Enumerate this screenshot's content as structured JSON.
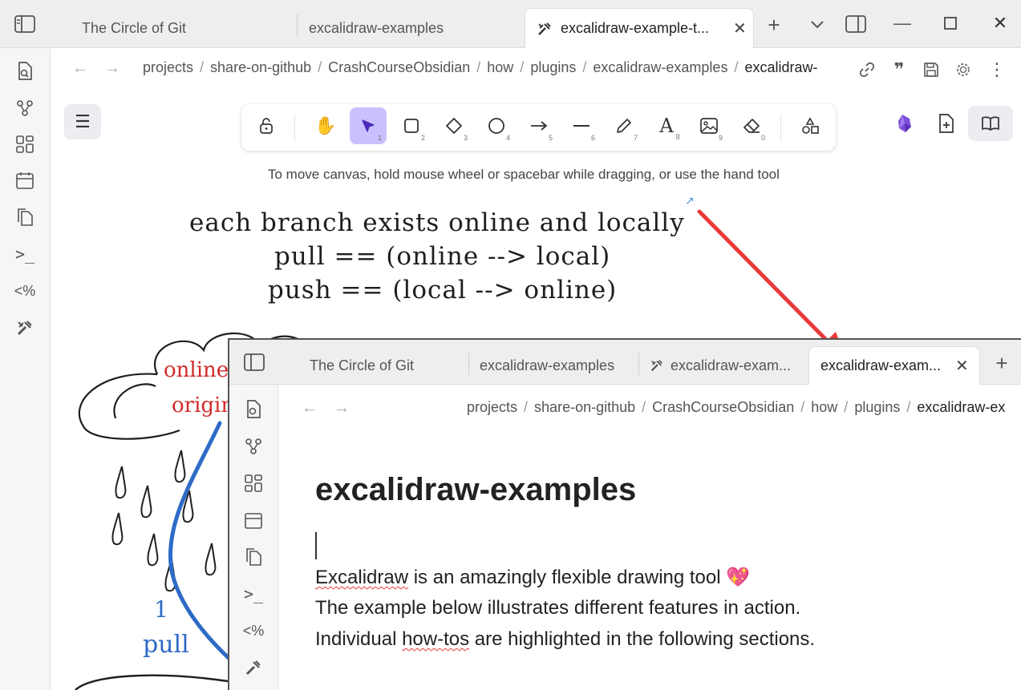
{
  "outer": {
    "tabs": [
      {
        "label": "The Circle of Git",
        "active": false
      },
      {
        "label": "excalidraw-examples",
        "active": false
      },
      {
        "label": "excalidraw-example-t...",
        "active": true
      }
    ],
    "breadcrumbs": [
      "projects",
      "share-on-github",
      "CrashCourseObsidian",
      "how",
      "plugins",
      "excalidraw-examples",
      "excalidraw-"
    ],
    "hint": "To move canvas, hold mouse wheel or spacebar while dragging, or use the hand tool",
    "tool_shortcuts": [
      "1",
      "2",
      "3",
      "4",
      "5",
      "6",
      "7",
      "8",
      "9",
      "0"
    ],
    "handwriting": [
      "each branch exists online and locally",
      "pull == (online --> local)",
      "push == (local --> online)"
    ],
    "cloud_text": [
      "online",
      "origin"
    ],
    "pull_text": [
      "1",
      "pull"
    ]
  },
  "inner": {
    "tabs": [
      {
        "label": "The Circle of Git",
        "active": false
      },
      {
        "label": "excalidraw-examples",
        "active": false
      },
      {
        "label": "excalidraw-exam...",
        "active": false
      },
      {
        "label": "excalidraw-exam...",
        "active": true
      }
    ],
    "breadcrumbs": [
      "projects",
      "share-on-github",
      "CrashCourseObsidian",
      "how",
      "plugins",
      "excalidraw-ex"
    ],
    "title": "excalidraw-examples",
    "lines": [
      {
        "misspelled": "Excalidraw",
        "rest": " is an amazingly flexible drawing tool 💖"
      },
      {
        "text": "The example below illustrates different features in action."
      },
      {
        "pre": "Individual ",
        "misspelled": "how-tos",
        "rest": " are highlighted in the following sections."
      }
    ]
  },
  "colors": {
    "accent_selected": "#c9c1ff",
    "arrow_red": "#e83a3a",
    "cloud_text_red": "#d22b2b",
    "pull_blue": "#2e6bc6"
  }
}
